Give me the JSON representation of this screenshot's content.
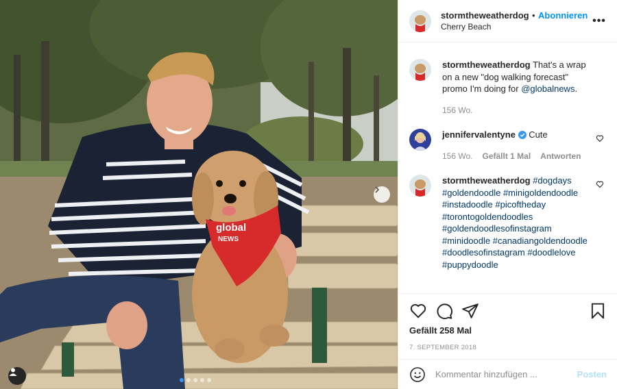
{
  "post": {
    "username": "stormtheweatherdog",
    "separator": "•",
    "follow_label": "Abonnieren",
    "location": "Cherry Beach",
    "more_label": "•••"
  },
  "caption": {
    "username": "stormtheweatherdog",
    "text_before": " That's a wrap on a new \"dog walking forecast\" promo I'm doing for ",
    "mention": "@globalnews",
    "text_after": ".",
    "time": "156 Wo."
  },
  "comments": [
    {
      "username": "jennifervalentyne",
      "text": "Cute",
      "time": "156 Wo.",
      "likes": "Gefällt 1 Mal",
      "reply": "Antworten"
    },
    {
      "username": "stormtheweatherdog",
      "hashtags": [
        "#dogdays",
        "#goldendoodle",
        "#minigoldendoodle",
        "#instadoodle",
        "#picoftheday",
        "#torontogoldendoodles",
        "#goldendoodlesofinstagram",
        "#minidoodle",
        "#canadiangoldendoodle",
        "#doodlesofinstagram",
        "#doodlelove",
        "#puppydoodle"
      ]
    }
  ],
  "actions": {
    "likes": "Gefällt 258 Mal",
    "date": "7. SEPTEMBER 2018"
  },
  "composer": {
    "placeholder": "Kommentar hinzufügen ...",
    "post_label": "Posten"
  },
  "photo": {
    "bandana_text_1": "global",
    "bandana_text_2": "NEWS"
  },
  "carousel": {
    "slide_count": 5,
    "active_index": 0
  },
  "colors": {
    "accent": "#0095f6",
    "link": "#00376b",
    "muted": "#8e8e8e",
    "bandana": "#d72b2b"
  }
}
